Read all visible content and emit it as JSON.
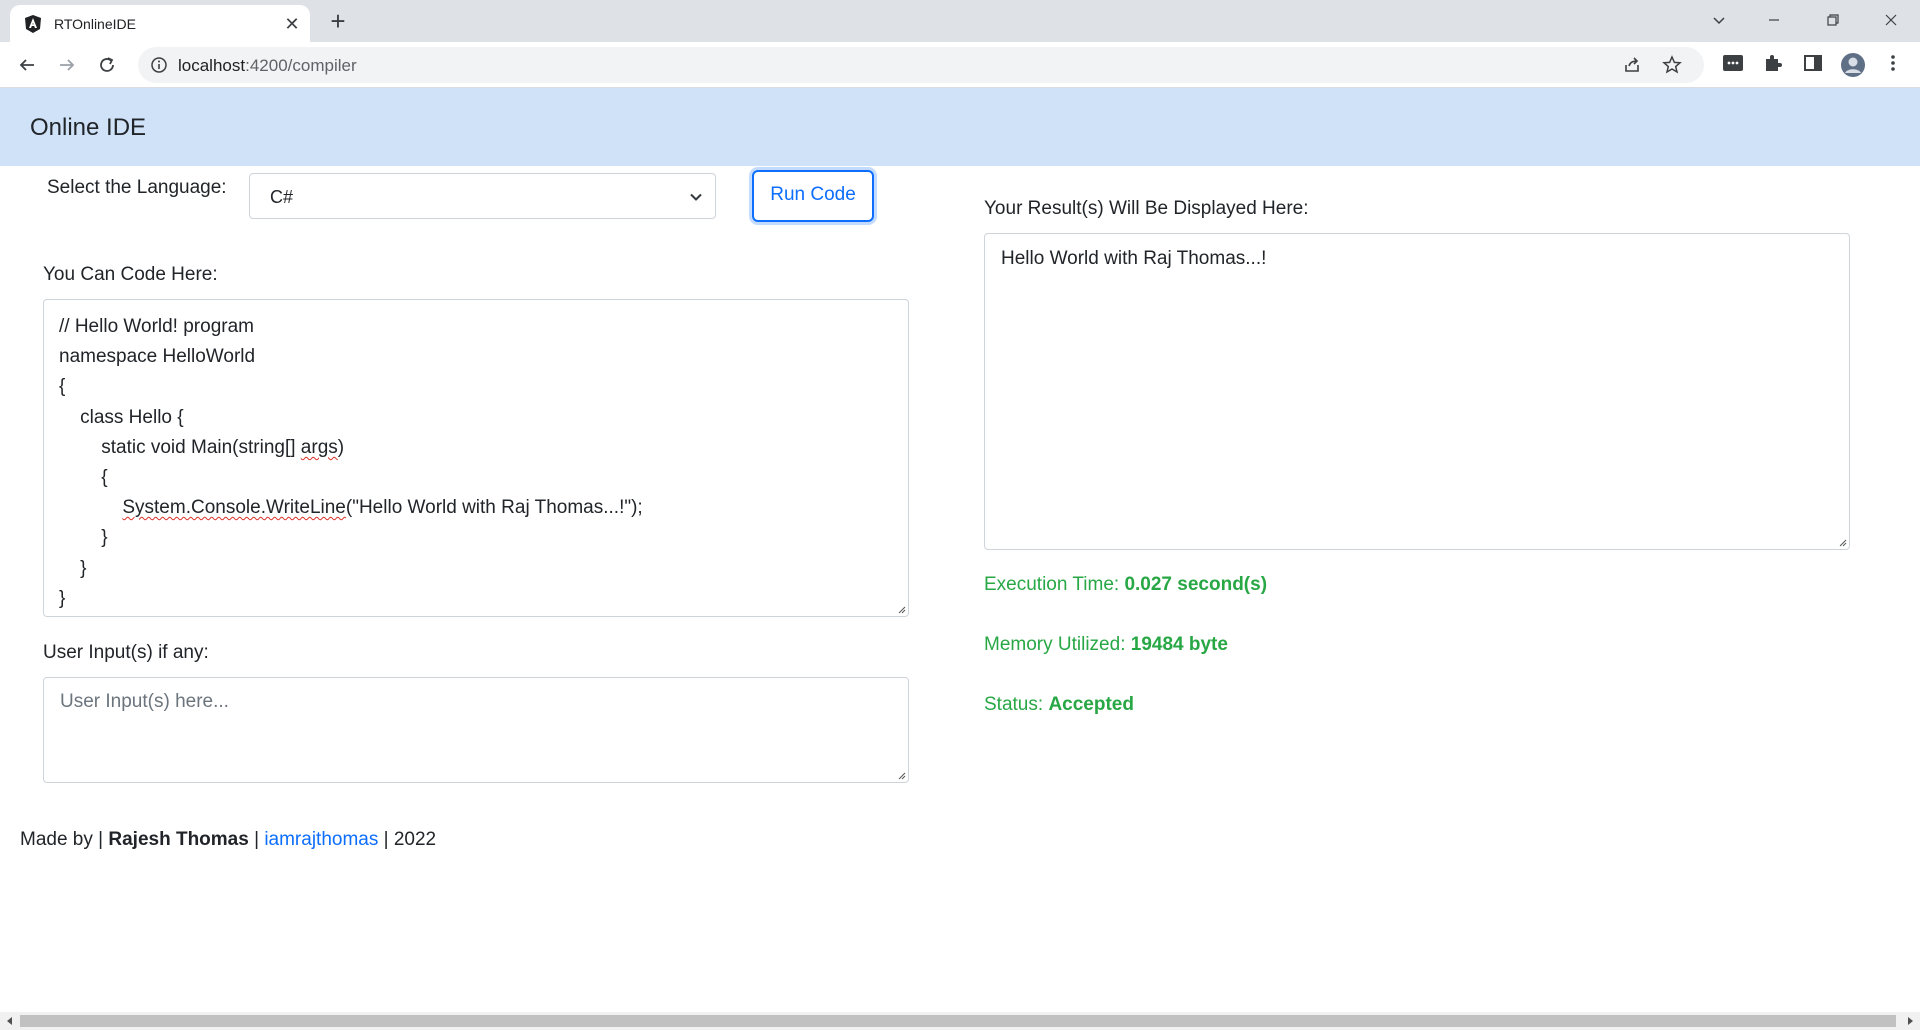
{
  "browser": {
    "tab_title": "RTOnlineIDE",
    "url_host": "localhost",
    "url_rest": ":4200/compiler"
  },
  "app": {
    "brand": "Online IDE"
  },
  "controls": {
    "language_label": "Select the Language:",
    "language_selected": "C#",
    "run_button": "Run Code"
  },
  "editor": {
    "label": "You Can Code Here:",
    "lines": [
      "// Hello World! program",
      "namespace HelloWorld",
      "{",
      "    class Hello {",
      "        static void Main(string[] args)",
      "        {",
      "            System.Console.WriteLine(\"Hello World with Raj Thomas...!\");",
      "        }",
      "    }",
      "}"
    ]
  },
  "user_input": {
    "label": "User Input(s) if any:",
    "placeholder": "User Input(s) here..."
  },
  "result": {
    "label": "Your Result(s) Will Be Displayed Here:",
    "output": "Hello World with Raj Thomas...!",
    "execution_time_label": "Execution Time:",
    "execution_time_value": "0.027 second(s)",
    "memory_label": "Memory Utilized:",
    "memory_value": "19484 byte",
    "status_label": "Status:",
    "status_value": "Accepted"
  },
  "footer": {
    "made_by": "Made by |",
    "author": "Rajesh Thomas",
    "sep1": "|",
    "handle": "iamrajthomas",
    "sep2": "| 2022"
  },
  "colors": {
    "navbar_bg": "#cfe2f8",
    "primary": "#0d6efd",
    "success": "#28a745"
  }
}
